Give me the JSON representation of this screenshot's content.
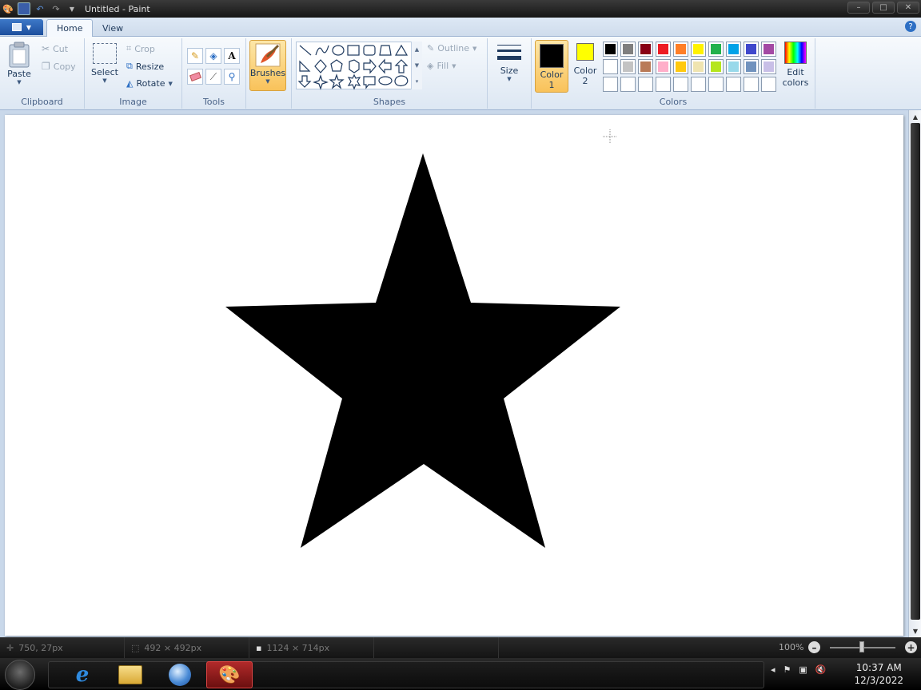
{
  "window": {
    "title": "Untitled - Paint"
  },
  "tabs": [
    {
      "label": "Home",
      "active": true
    },
    {
      "label": "View",
      "active": false
    }
  ],
  "ribbon": {
    "clipboard": {
      "group_label": "Clipboard",
      "paste": "Paste",
      "cut": "Cut",
      "copy": "Copy"
    },
    "image": {
      "group_label": "Image",
      "select": "Select",
      "crop": "Crop",
      "resize": "Resize",
      "rotate": "Rotate"
    },
    "tools": {
      "group_label": "Tools"
    },
    "brushes": {
      "label": "Brushes"
    },
    "shapes": {
      "group_label": "Shapes",
      "outline": "Outline",
      "fill": "Fill"
    },
    "size": {
      "label": "Size"
    },
    "colors": {
      "group_label": "Colors",
      "color1_label": "Color",
      "color1_num": "1",
      "color2_label": "Color",
      "color2_num": "2",
      "color1_value": "#000000",
      "color2_value": "#ffff00",
      "edit_colors_line1": "Edit",
      "edit_colors_line2": "colors",
      "palette_row1": [
        "#000000",
        "#7f7f7f",
        "#880015",
        "#ed1c24",
        "#ff7f27",
        "#fff200",
        "#22b14c",
        "#00a2e8",
        "#3f48cc",
        "#a349a4"
      ],
      "palette_row2": [
        "#ffffff",
        "#c3c3c3",
        "#b97a57",
        "#ffaec9",
        "#ffc90e",
        "#efe4b0",
        "#b5e61d",
        "#99d9ea",
        "#7092be",
        "#c8bfe7"
      ]
    }
  },
  "canvas": {
    "star_color": "#000000"
  },
  "statusbar": {
    "cursor_pos": "750, 27px",
    "selection_size": "492 × 492px",
    "image_size": "1124 × 714px",
    "zoom": "100%"
  },
  "taskbar": {
    "time": "10:37 AM",
    "date": "12/3/2022",
    "apps": [
      {
        "name": "internet-explorer-icon",
        "active": false
      },
      {
        "name": "file-explorer-icon",
        "active": false
      },
      {
        "name": "media-player-icon",
        "active": false
      },
      {
        "name": "paint-icon",
        "active": true
      }
    ]
  }
}
